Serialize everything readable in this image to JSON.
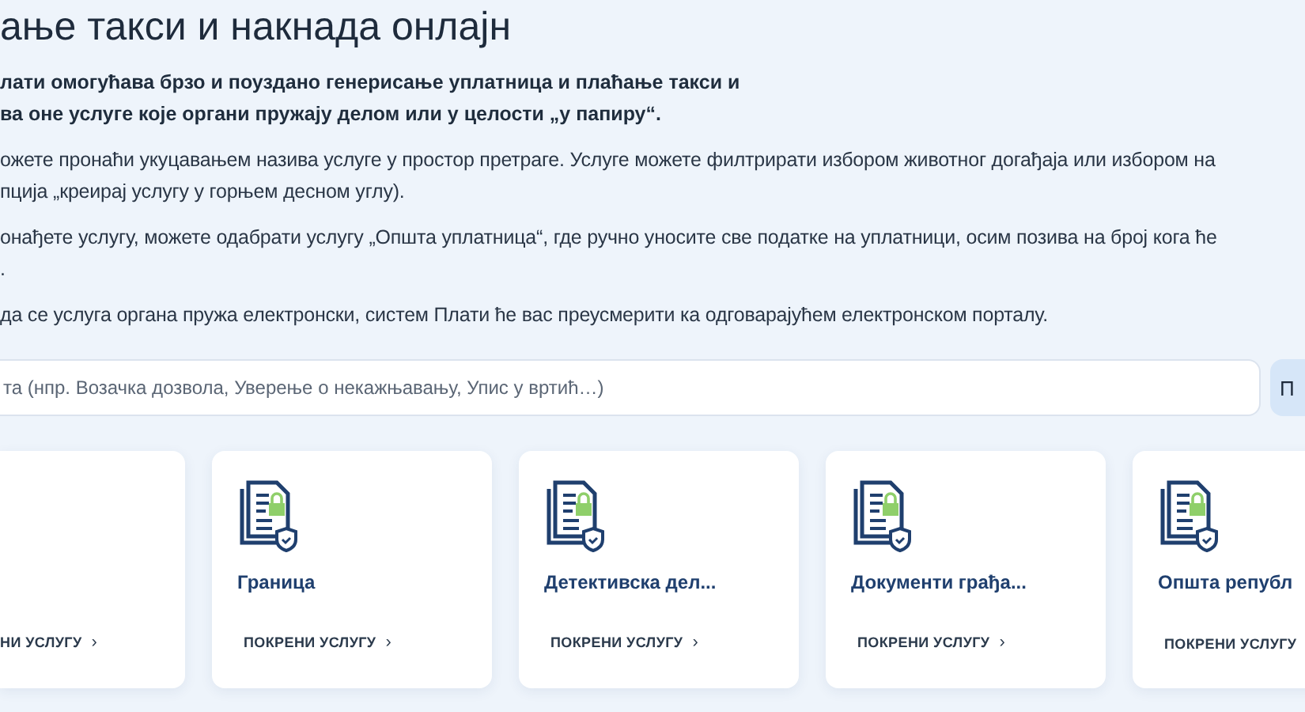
{
  "title": "ање такси и накнада онлајн",
  "intro": [
    "лати омогућава брзо и поуздано генерисање уплатница и плаћање такси и",
    "ва оне услуге које органи пружају делом или у целости „у папиру“."
  ],
  "paragraphs": [
    [
      "ожете пронаћи укуцавањем назива услуге у простор претраге. Услуге можете филтрирати избором животног догађаја или избором на",
      "пција „креирај услугу у горњем десном углу)."
    ],
    [
      "онађете услугу, можете одабрати услугу „Општа уплатница“, где ручно уносите све податке на уплатници, осим позива на број кога ће",
      "."
    ],
    [
      "да се услуга органа пружа електронски, систем Плати ће вас преусмерити ка одговарајућем електронском порталу."
    ]
  ],
  "search": {
    "placeholder": "та (нпр. Возачка дозвола, Уверење о некажњавању, Упис у вртић…)",
    "button": "П"
  },
  "cards": [
    {
      "kind": "partial",
      "link": "НИ УСЛУГУ",
      "chevron": "›"
    },
    {
      "kind": "full",
      "title": "Граница",
      "link": "ПОКРЕНИ УСЛУГУ",
      "chevron": "›"
    },
    {
      "kind": "full",
      "title": "Детективска дел...",
      "link": "ПОКРЕНИ УСЛУГУ",
      "chevron": "›"
    },
    {
      "kind": "full",
      "title": "Документи грађа...",
      "link": "ПОКРЕНИ УСЛУГУ",
      "chevron": "›"
    },
    {
      "kind": "full",
      "title": "Општа републ",
      "link": "ПОКРЕНИ УСЛУГУ"
    }
  ]
}
